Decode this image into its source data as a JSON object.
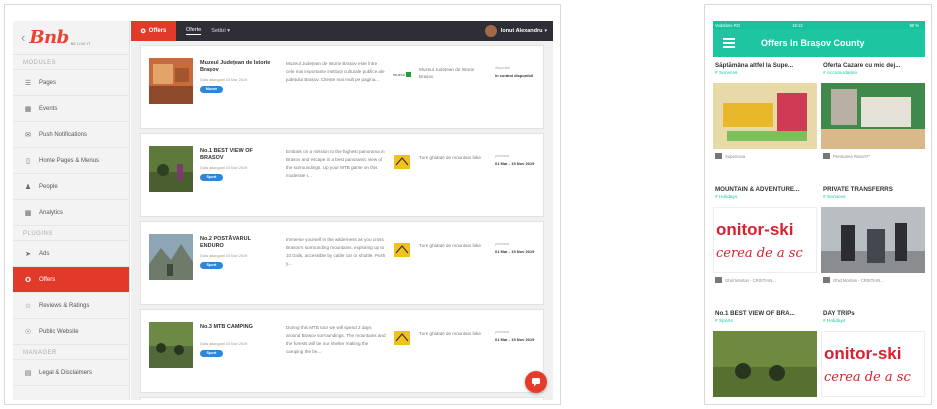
{
  "desktop": {
    "logo": "Bnb",
    "logo_sub": "BE LIVE IT",
    "sidebar": {
      "sections": [
        "MODULES",
        "PLUGINS",
        "MANAGER"
      ],
      "modules": [
        {
          "label": "Pages",
          "icon": "list-icon"
        },
        {
          "label": "Events",
          "icon": "calendar-icon"
        },
        {
          "label": "Push Notifications",
          "icon": "mail-icon"
        },
        {
          "label": "Home Pages & Menus",
          "icon": "phone-icon"
        },
        {
          "label": "People",
          "icon": "person-icon"
        },
        {
          "label": "Analytics",
          "icon": "chart-icon"
        }
      ],
      "plugins": [
        {
          "label": "Ads",
          "icon": "megaphone-icon"
        },
        {
          "label": "Offers",
          "icon": "tag-icon",
          "active": true
        },
        {
          "label": "Reviews & Ratings",
          "icon": "review-icon"
        },
        {
          "label": "Public Website",
          "icon": "globe-icon"
        }
      ],
      "manager": [
        {
          "label": "Legal & Disclaimers",
          "icon": "document-icon"
        }
      ]
    },
    "topbar": {
      "brand": "Offers",
      "tabs": [
        "Oferte",
        "Setări"
      ],
      "user": "Ionut Alexandru"
    },
    "offers": [
      {
        "title": "Muzeul Județean de Istorie Brașov",
        "meta": "Data adaugarii 18 Mar 2019",
        "tag": "Muzee",
        "desc": "Muzeul Județean de Istorie Brașov este între cele mai importante instituții culturale publice ale județului Brașov. Citește mai mult pe pagina...",
        "partner": "Muzeul Județean de Istorie Brașov",
        "period_label": "disponibil",
        "period": "în curând disponibil"
      },
      {
        "title": "No.1 BEST VIEW OF BRASOV",
        "meta": "Data adaugarii 03 Nov 2019",
        "tag": "Sport",
        "desc": "Embark on a mission to the highest panorama in Brasov and escape in a best panoramic view of the surroundings. Up your MTB game on this moderate t...",
        "partner": "Ture ghidate de mountain bike",
        "period_label": "perioada",
        "period": "01 Mar - 15 Nov 2019"
      },
      {
        "title": "No.2 POSTĂVARUL ENDURO",
        "meta": "Data adaugarii 03 Nov 2019",
        "tag": "Sport",
        "desc": "Immerse yourself in the wilderness as you cross Brasov's surrounding mountains, exploring up to 10 trails, accessible by cable car or shuttle. Push y...",
        "partner": "Ture ghidate de mountain bike",
        "period_label": "perioada",
        "period": "01 Mar - 15 Nov 2019"
      },
      {
        "title": "No.3 MTB CAMPING",
        "meta": "Data adaugarii 03 Nov 2019",
        "tag": "Sport",
        "desc": "During this MTB tour we will spend 2 days around Brasov surroundings. The mountains and the forests will be our shelter making the camping the be...",
        "partner": "Ture ghidate de mountain bike",
        "period_label": "perioada",
        "period": "01 Mar - 15 Nov 2019"
      }
    ]
  },
  "mobile": {
    "status": {
      "carrier": "Vodafone RO",
      "time": "19:13",
      "battery": "90 %"
    },
    "title": "Offers In Brașov County",
    "cards": [
      {
        "title": "Săptămâna altfel la Supe...",
        "category": "# Services",
        "owner": "Supernova"
      },
      {
        "title": "Oferta Cazare cu mic dej...",
        "category": "# Accomodation",
        "owner": "Pensiunea Rosa's**"
      },
      {
        "title": "MOUNTAIN & ADVENTURE...",
        "category": "# Holidays",
        "owner": "Ghid Montan - CRISTIAN..."
      },
      {
        "title": "PRIVATE TRANSFERRS",
        "category": "# Services",
        "owner": "Ghid Montan - CRISTIAN..."
      },
      {
        "title": "No.1 BEST VIEW OF BRA...",
        "category": "# Sports",
        "owner": ""
      },
      {
        "title": "DAY TRIPs",
        "category": "# Holidays",
        "owner": ""
      }
    ],
    "banner_line1": "onitor-ski",
    "banner_line2": "cerea de a sc"
  }
}
